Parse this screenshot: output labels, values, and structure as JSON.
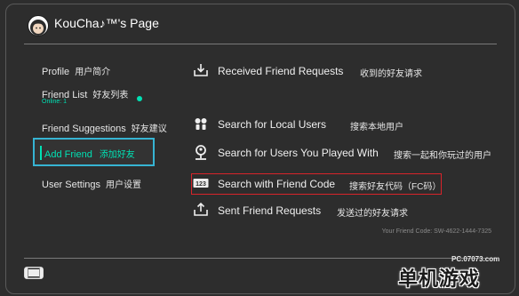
{
  "header": {
    "title": "KouCha♪™'s Page"
  },
  "sidebar": {
    "profile": {
      "en": "Profile",
      "cn": "用户简介"
    },
    "friend_list": {
      "en": "Friend List",
      "cn": "好友列表",
      "status": "Online: 1"
    },
    "friend_suggestions": {
      "en": "Friend Suggestions",
      "cn": "好友建议"
    },
    "add_friend": {
      "en": "Add Friend",
      "cn": "添加好友"
    },
    "user_settings": {
      "en": "User Settings",
      "cn": "用户设置"
    }
  },
  "menu": {
    "received": {
      "en": "Received Friend Requests",
      "cn": "收到的好友请求",
      "icon": "inbox-download-icon"
    },
    "local": {
      "en": "Search for Local Users",
      "cn": "搜索本地用户",
      "icon": "local-users-icon"
    },
    "played": {
      "en": "Search for Users You Played With",
      "cn": "搜索一起和你玩过的用户",
      "icon": "user-search-icon"
    },
    "code": {
      "en": "Search with Friend Code",
      "cn": "搜索好友代码（FC码）",
      "icon": "123-code-icon"
    },
    "sent": {
      "en": "Sent Friend Requests",
      "cn": "发送过的好友请求",
      "icon": "outbox-upload-icon"
    }
  },
  "friend_code": "Your Friend Code: SW-4622-1444-7325",
  "watermark": {
    "url": "PC.07073.com",
    "logo": "单机游戏"
  },
  "colors": {
    "accent": "#00e1b4",
    "focus_border": "#36b4d3",
    "highlight_red": "#d8232a",
    "bg": "#2d2d2d"
  }
}
